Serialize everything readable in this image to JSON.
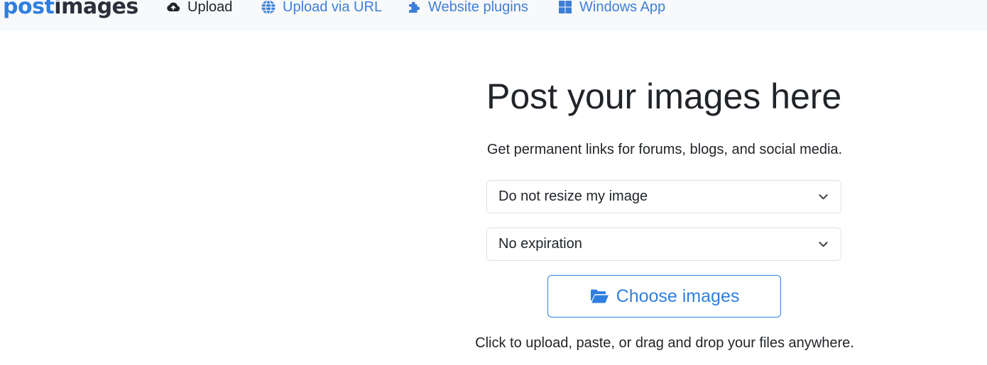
{
  "brand": {
    "logo_part1": "post",
    "logo_part2": "images",
    "accent_color": "#2f7fe0"
  },
  "nav": {
    "items": [
      {
        "label": "Upload",
        "icon": "cloud-upload-icon",
        "active": true
      },
      {
        "label": "Upload via URL",
        "icon": "globe-icon",
        "active": false
      },
      {
        "label": "Website plugins",
        "icon": "puzzle-icon",
        "active": false
      },
      {
        "label": "Windows App",
        "icon": "windows-icon",
        "active": false
      }
    ]
  },
  "main": {
    "title": "Post your images here",
    "subtitle": "Get permanent links for forums, blogs, and social media.",
    "resize_select": {
      "value": "Do not resize my image",
      "icon": "chevron-down-icon"
    },
    "expiration_select": {
      "value": "No expiration",
      "icon": "chevron-down-icon"
    },
    "choose_button": {
      "label": "Choose images",
      "icon": "folder-open-icon"
    },
    "hint": "Click to upload, paste, or drag and drop your files anywhere."
  }
}
